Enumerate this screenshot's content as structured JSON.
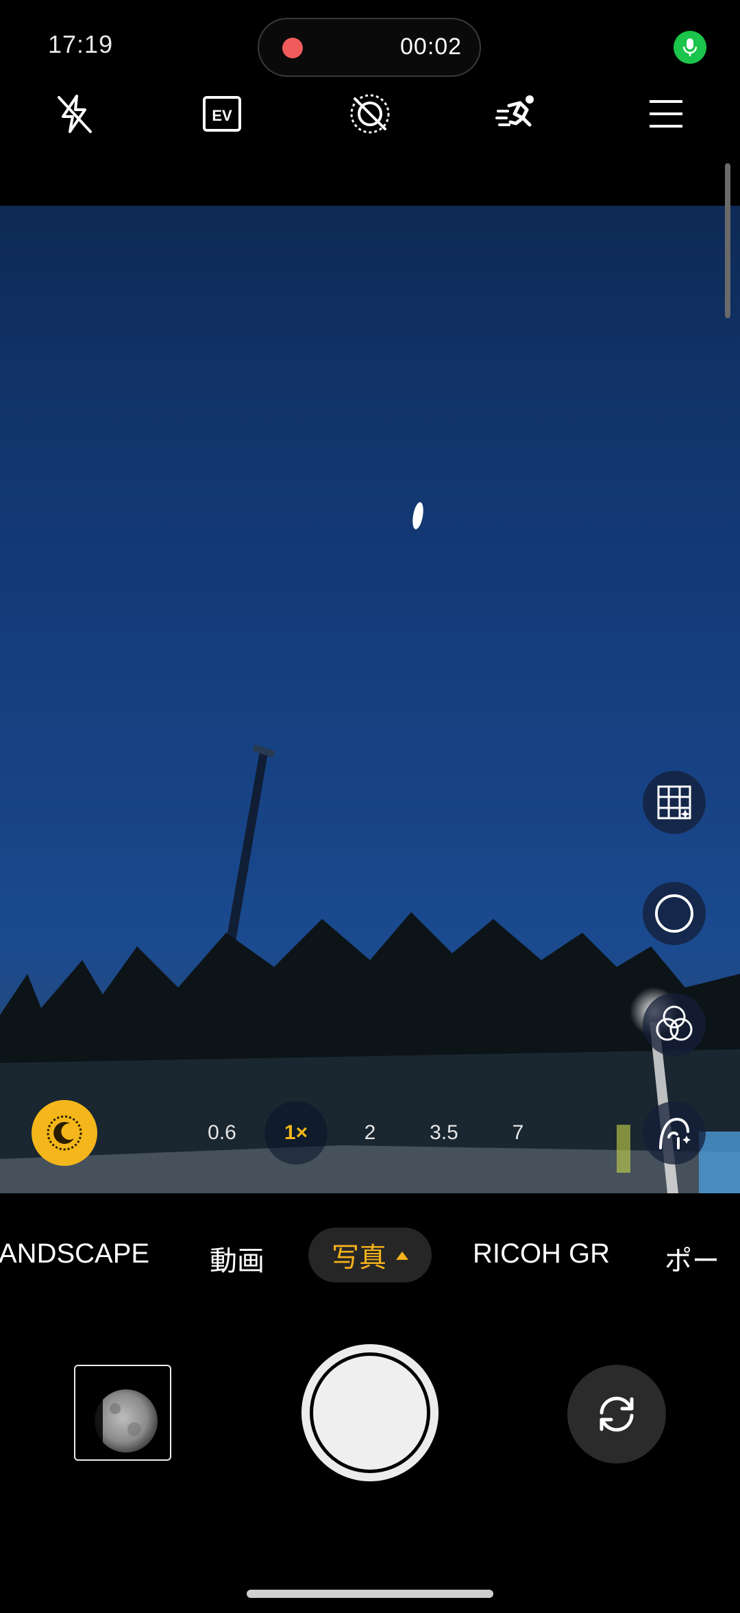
{
  "status": {
    "time": "17:19",
    "recording_time": "00:02",
    "recording_dot_color": "#f25b5b",
    "mic_color": "#1bc44a"
  },
  "toolbar": {
    "icons": [
      "flash-off-icon",
      "ev-icon",
      "motion-photo-off-icon",
      "action-mode-icon",
      "menu-icon"
    ],
    "ev_label": "EV"
  },
  "zoom": {
    "levels": [
      "0.6",
      "1×",
      "2",
      "3.5",
      "7"
    ],
    "active": "1×",
    "active_color": "#f4b61a"
  },
  "side_controls": [
    "grid-icon",
    "shutter-style-icon",
    "filters-icon",
    "portrait-retouch-icon"
  ],
  "modes": {
    "items": [
      "ANDSCAPE",
      "動画",
      "写真",
      "RICOH GR",
      "ポー"
    ],
    "active": "写真",
    "active_color": "#f6b21b"
  },
  "night_mode_color": "#f4b61a"
}
